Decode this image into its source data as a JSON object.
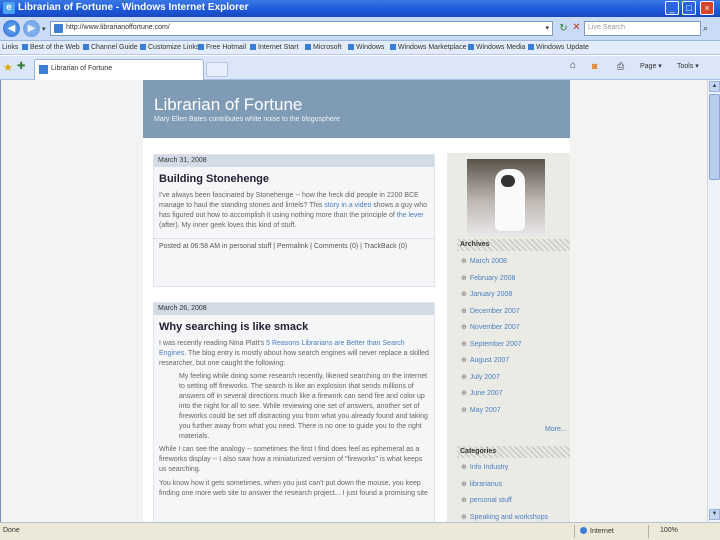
{
  "window": {
    "title": "Librarian of Fortune - Windows Internet Explorer"
  },
  "address": {
    "url": "http://www.librarianoffortune.com/"
  },
  "search": {
    "placeholder": "Live Search"
  },
  "links": {
    "label": "Links",
    "items": [
      "Best of the Web",
      "Channel Guide",
      "Customize Links",
      "Free Hotmail",
      "Internet Start",
      "Microsoft",
      "Windows",
      "Windows Marketplace",
      "Windows Media",
      "Windows Update"
    ]
  },
  "tab": {
    "label": "Librarian of Fortune"
  },
  "commands": {
    "page": "Page ▾",
    "tools": "Tools ▾"
  },
  "blog": {
    "title": "Librarian of Fortune",
    "description": "Mary Ellen Bates contributes white noise to the blogosphere"
  },
  "posts": [
    {
      "date": "March 31, 2008",
      "title": "Building Stonehenge",
      "text_1": "I've always been fascinated by Stonehenge -- how the heck did people in 2200 BCE manage to haul the standing stones and lintels? This ",
      "link_1": "story in a video",
      "text_2": " shows a guy who has figured out how to accomplish it using nothing more than the principle of ",
      "link_2": "the lever",
      "text_3": " (after). My inner geek loves this kind of stuff.",
      "footer": "Posted at 06:58 AM in personal stuff | Permalink | Comments (0) | TrackBack (0)"
    },
    {
      "date": "March 26, 2008",
      "title": "Why searching is like smack",
      "intro_1": "I was recently reading Nina Platt's ",
      "intro_link": "5 Reasons Librarians are Better than Search Engines",
      "intro_2": ". The blog entry is mostly about how search engines will never replace a skilled researcher, but one caught the following:",
      "quote": "My feeling while doing some research recently, likened searching on the internet to setting off fireworks. The search is like an explosion that sends millions of answers off in several directions much like a firework can send fire and color up into the night for all to see. While reviewing one set of answers, another set of fireworks could be set off distracting you from what you already found and taking you further away from what you need. There is no one to guide you to the right materials.",
      "p2": "While I can see the analogy -- sometimes the first I find does feel as ephemeral as a fireworks display -- I also saw how a miniaturized version of \"fireworks\" is what keeps us searching.",
      "p3": "You know how it gets sometimes, when you just can't put down the mouse, you keep finding one more web site to answer the research project... I just found a promising site"
    }
  ],
  "sidebar": {
    "archives_heading": "Archives",
    "archives": [
      "March 2008",
      "February 2008",
      "January 2008",
      "December 2007",
      "November 2007",
      "September 2007",
      "August 2007",
      "July 2007",
      "June 2007",
      "May 2007"
    ],
    "more": "More...",
    "categories_heading": "Categories",
    "categories": [
      "Info Industry",
      "librarianus",
      "personal stuff",
      "Speaking and workshops"
    ]
  },
  "status": {
    "text": "Done",
    "zone": "Internet",
    "zoom": "100%"
  }
}
